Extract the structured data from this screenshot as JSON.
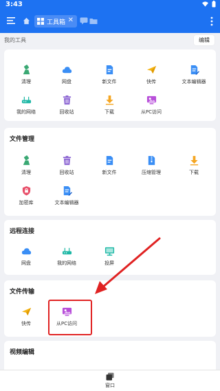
{
  "status_bar": {
    "time": "3:43"
  },
  "top_bar": {
    "tab_label": "工具箱",
    "tab_close": "✕"
  },
  "my_tools": {
    "title": "我的工具",
    "edit_label": "编辑",
    "items": [
      {
        "label": "清理",
        "icon": "broom-icon"
      },
      {
        "label": "网盘",
        "icon": "cloud-icon"
      },
      {
        "label": "新文件",
        "icon": "new-file-icon"
      },
      {
        "label": "快传",
        "icon": "paper-plane-icon"
      },
      {
        "label": "文本编辑器",
        "icon": "text-editor-icon"
      },
      {
        "label": "我的网络",
        "icon": "router-icon"
      },
      {
        "label": "回收站",
        "icon": "trash-icon"
      },
      {
        "label": "下载",
        "icon": "download-icon"
      },
      {
        "label": "从PC访问",
        "icon": "pc-access-icon"
      }
    ]
  },
  "file_management": {
    "title": "文件管理",
    "items": [
      {
        "label": "清理",
        "icon": "broom-icon"
      },
      {
        "label": "回收站",
        "icon": "trash-icon"
      },
      {
        "label": "新文件",
        "icon": "new-file-icon"
      },
      {
        "label": "压缩管理",
        "icon": "archive-icon"
      },
      {
        "label": "下载",
        "icon": "download-icon"
      },
      {
        "label": "加密库",
        "icon": "shield-icon"
      },
      {
        "label": "文本编辑器",
        "icon": "text-editor-icon"
      }
    ]
  },
  "remote_connection": {
    "title": "远程连接",
    "items": [
      {
        "label": "网盘",
        "icon": "cloud-icon"
      },
      {
        "label": "我的网络",
        "icon": "router-icon"
      },
      {
        "label": "投屏",
        "icon": "cast-icon"
      }
    ]
  },
  "file_transfer": {
    "title": "文件传输",
    "items": [
      {
        "label": "快传",
        "icon": "paper-plane-icon"
      },
      {
        "label": "从PC访问",
        "icon": "pc-access-icon"
      }
    ]
  },
  "video_editing": {
    "title": "视频编辑"
  },
  "bottom_bar": {
    "window_label": "窗口"
  },
  "colors": {
    "brand_blue": "#1d72f2",
    "broom_green": "#3aa873",
    "download_yellow": "#f5a623",
    "pc_purple": "#b84fd9",
    "shield_red": "#e8506a",
    "highlight_red": "#e02222"
  }
}
